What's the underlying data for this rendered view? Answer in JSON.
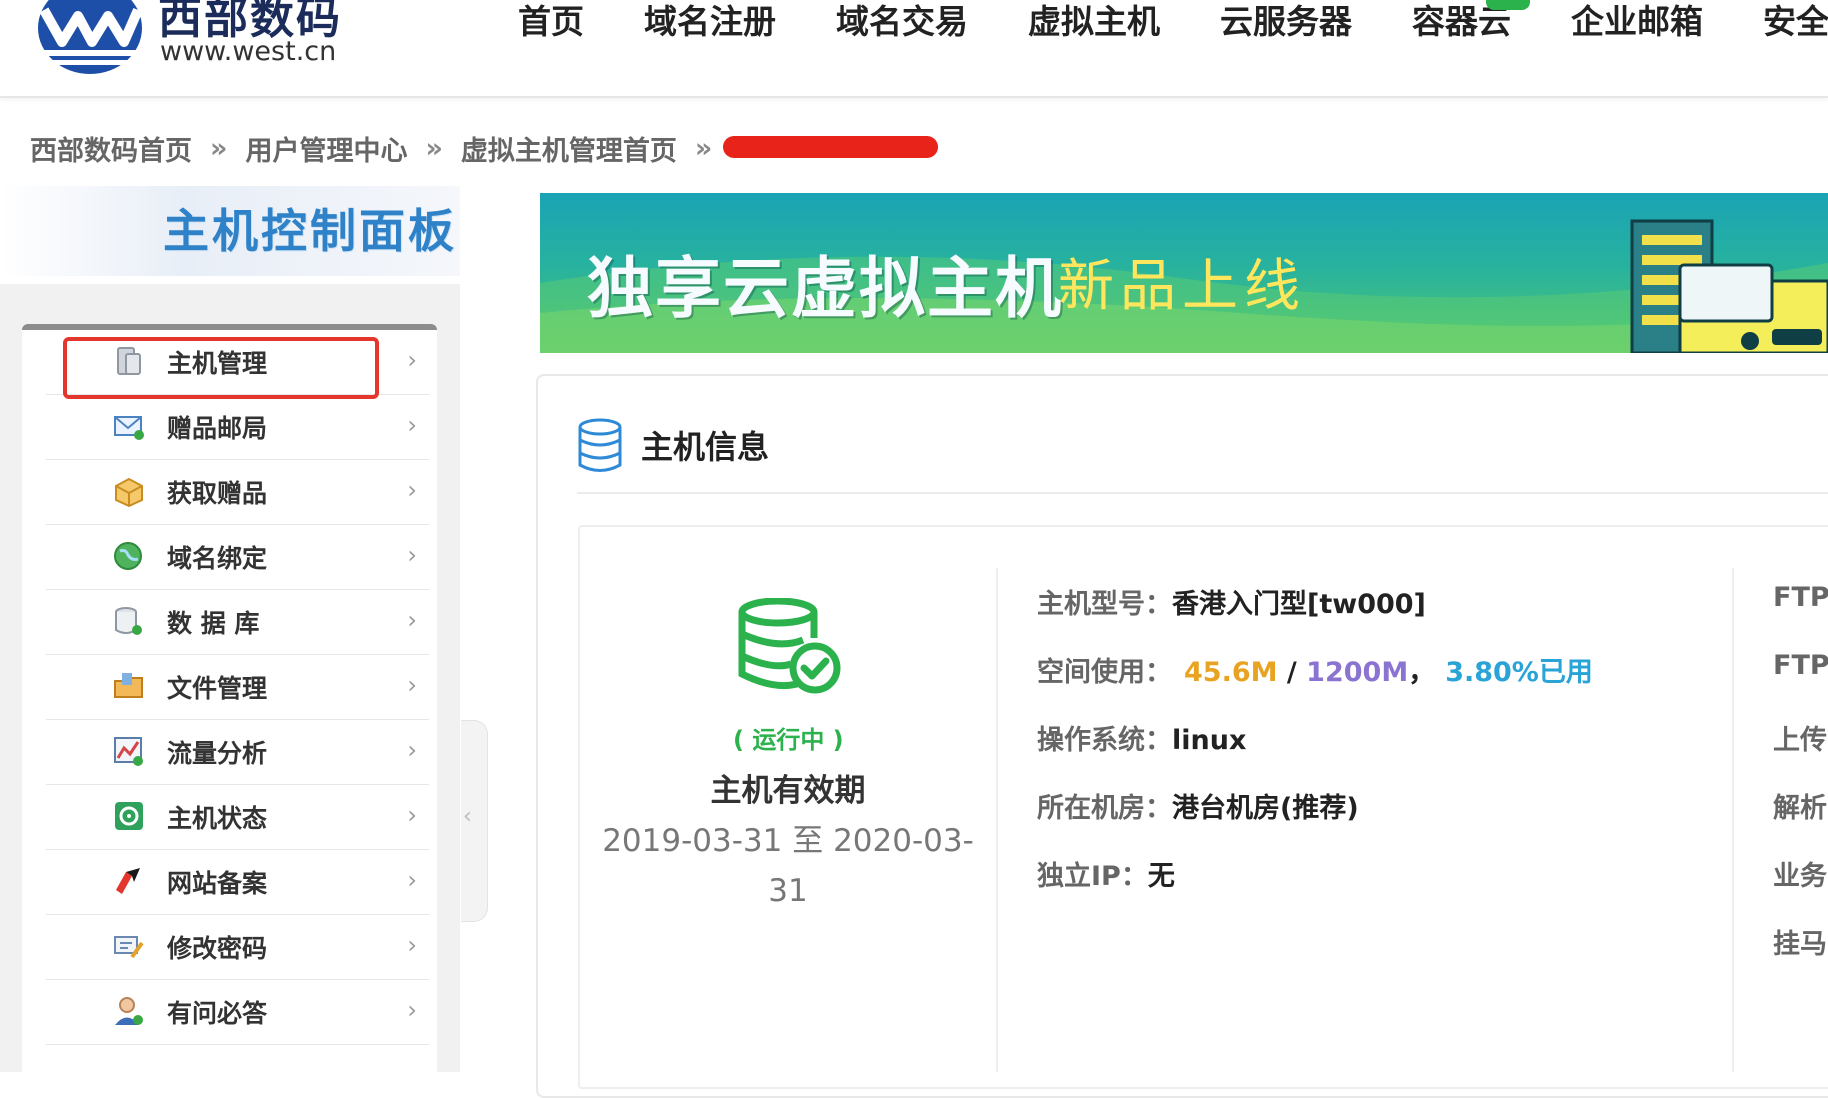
{
  "logo": {
    "cn": "西部数码",
    "url": "www.west.cn"
  },
  "nav": [
    "首页",
    "域名注册",
    "域名交易",
    "虚拟主机",
    "云服务器",
    "容器云",
    "企业邮箱",
    "安全"
  ],
  "breadcrumb": [
    "西部数码首页",
    "用户管理中心",
    "虚拟主机管理首页"
  ],
  "breadcrumb_sep": "»",
  "sidebar": {
    "title": "主机控制面板",
    "items": [
      {
        "label": "主机管理",
        "icon": "server-icon",
        "selected": true
      },
      {
        "label": "赠品邮局",
        "icon": "mail-icon"
      },
      {
        "label": "获取赠品",
        "icon": "gift-box-icon"
      },
      {
        "label": "域名绑定",
        "icon": "globe-icon"
      },
      {
        "label": "数 据 库",
        "icon": "database-icon"
      },
      {
        "label": "文件管理",
        "icon": "folder-icon"
      },
      {
        "label": "流量分析",
        "icon": "chart-icon"
      },
      {
        "label": "主机状态",
        "icon": "status-icon"
      },
      {
        "label": "网站备案",
        "icon": "record-icon"
      },
      {
        "label": "修改密码",
        "icon": "password-icon"
      },
      {
        "label": "有问必答",
        "icon": "support-user-icon"
      }
    ],
    "chevron": "›",
    "collapse_arrow": "‹"
  },
  "banner": {
    "title": "独享云虚拟主机",
    "subtitle": "新品上线"
  },
  "host_info": {
    "title": "主机信息",
    "status": "( 运行中 )",
    "valid_label": "主机有效期",
    "valid_range": "2019-03-31 至 2020-03-31",
    "model_label": "主机型号：",
    "model_value": "香港入门型[tw000]",
    "space_label": "空间使用：",
    "space_used": "45.6M",
    "space_sep": " / ",
    "space_total": "1200M",
    "space_comma": "，",
    "space_pct": "3.80%已用",
    "os_label": "操作系统：",
    "os_value": "linux",
    "room_label": "所在机房：",
    "room_value": "港台机房(推荐)",
    "ip_label": "独立IP：",
    "ip_value": "无"
  },
  "right_col_labels": [
    "FTP",
    "FTP",
    "上传",
    "解析",
    "业务",
    "挂马"
  ],
  "colors": {
    "accent_green": "#2bb24c",
    "used": "#e8a322",
    "total": "#8a73d1",
    "pct": "#2aa3d6",
    "highlight": "#e3362c"
  }
}
